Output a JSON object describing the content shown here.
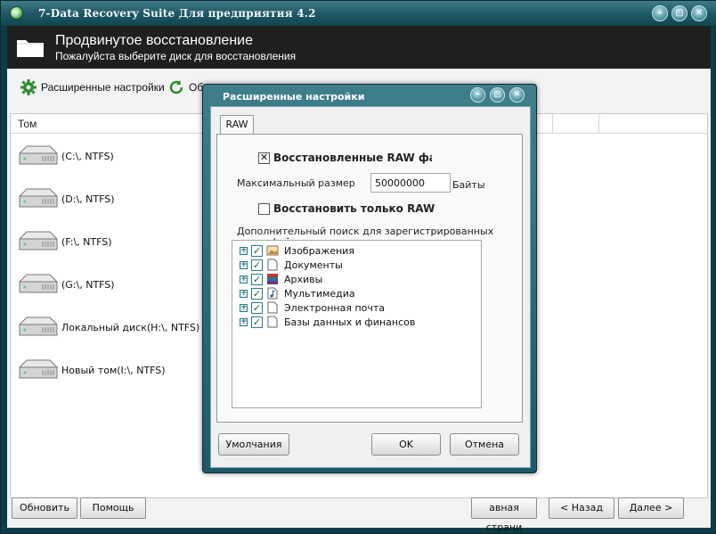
{
  "window": {
    "title": "7-Data Recovery Suite Для предприятия 4.2",
    "controls": [
      "–",
      "□",
      "✕"
    ]
  },
  "header": {
    "title": "Продвинутое восстановление",
    "subtitle": "Пожалуйста выберите диск для восстановления"
  },
  "toolbar": {
    "advanced_label": "Расширенные настройки",
    "refresh_label": "Об"
  },
  "list": {
    "column_header": "Том",
    "drives": [
      {
        "label": "(C:\\, NTFS)"
      },
      {
        "label": "(D:\\, NTFS)"
      },
      {
        "label": "(F:\\, NTFS)"
      },
      {
        "label": "(G:\\, NTFS)"
      },
      {
        "label": "Локальный диск(H:\\, NTFS)"
      },
      {
        "label": "Новый том(I:\\, NTFS)"
      }
    ]
  },
  "footer": {
    "refresh": "Обновить",
    "help": "Помощь",
    "home": "авная страни",
    "back": "< Назад",
    "next": "Далее >"
  },
  "dialog": {
    "title": "Расширенные настройки",
    "tab": "RAW",
    "recovered_raw_label": "Восстановленные RAW файлы",
    "recovered_raw_checked": true,
    "max_size_label": "Максимальный размер",
    "max_size_value": "50000000",
    "max_size_unit": "Байты",
    "only_raw_label": "Восстановить только RAW фай",
    "only_raw_checked": false,
    "extra_search_label_1": "Дополнительный поиск для зарегистрированных",
    "extra_search_label_2": "типов файлов:",
    "types": [
      {
        "label": "Изображения",
        "icon": "image-icon",
        "checked": true
      },
      {
        "label": "Документы",
        "icon": "document-icon",
        "checked": true
      },
      {
        "label": "Архивы",
        "icon": "archive-icon",
        "checked": true
      },
      {
        "label": "Мультимедиа",
        "icon": "music-icon",
        "checked": true
      },
      {
        "label": "Электронная почта",
        "icon": "email-icon",
        "checked": true
      },
      {
        "label": "Базы данных и финансов",
        "icon": "database-icon",
        "checked": true
      }
    ],
    "defaults_button": "Умолчания",
    "ok_button": "OK",
    "cancel_button": "Отмена"
  }
}
